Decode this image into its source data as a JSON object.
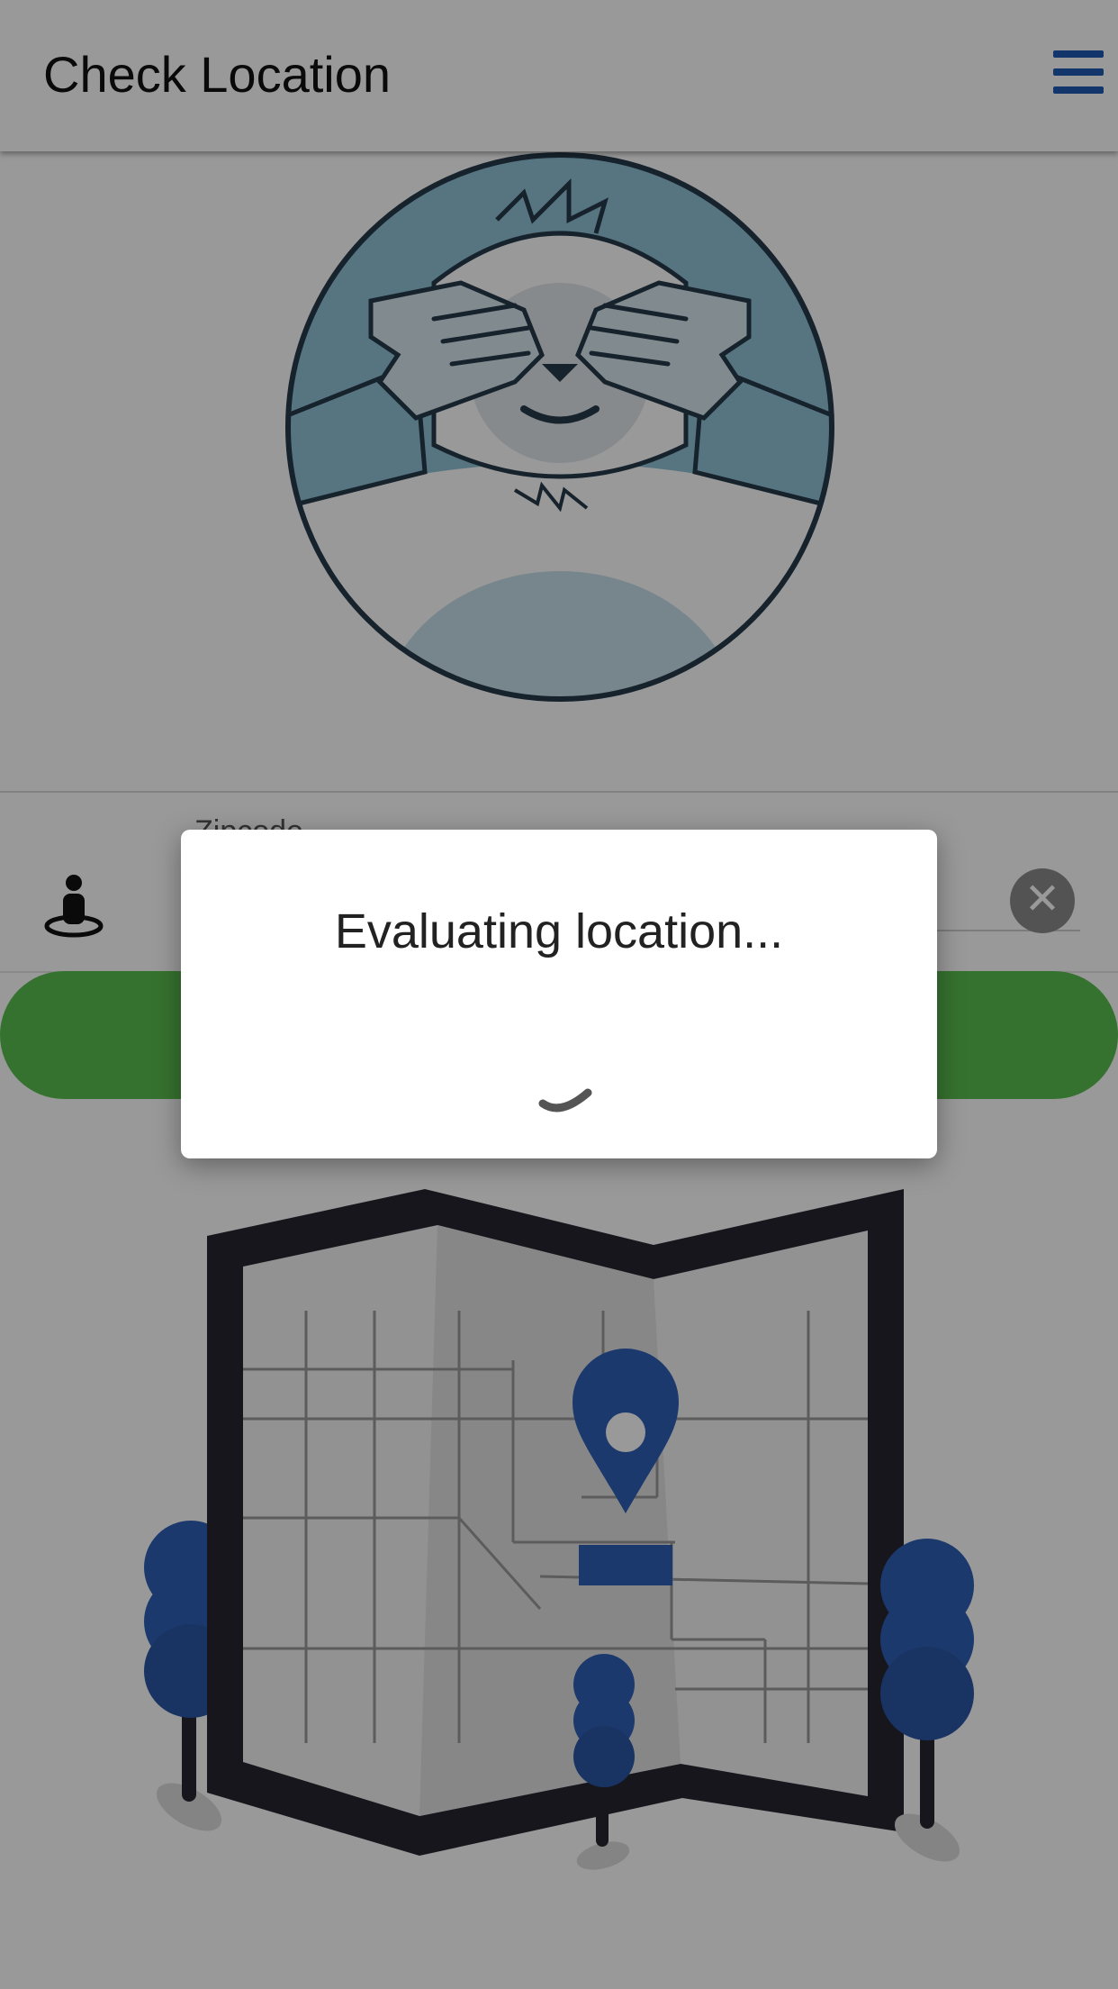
{
  "header": {
    "title": "Check Location"
  },
  "form": {
    "zipcode_label": "Zipcode",
    "zipcode_value": ""
  },
  "dialog": {
    "message": "Evaluating location..."
  },
  "colors": {
    "accent": "#1f5ab5",
    "button_green": "#5bbf4f",
    "pin_blue": "#2f5fb8",
    "map_frame": "#26262f",
    "hero_blue": "#8fc3d8"
  }
}
